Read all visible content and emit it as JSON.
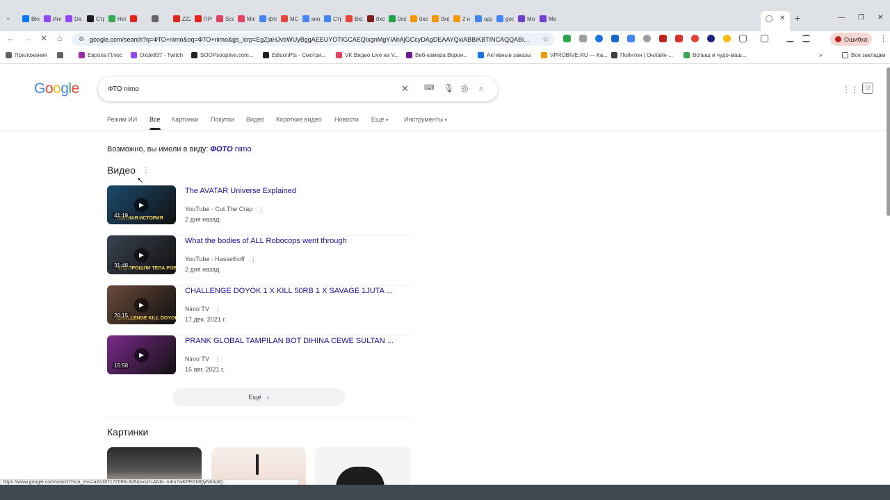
{
  "browser": {
    "tabs": [
      {
        "label": "ВКс",
        "color": "#0077ff"
      },
      {
        "label": "Инс",
        "color": "#9146ff"
      },
      {
        "label": "Da",
        "color": "#9146ff"
      },
      {
        "label": "Стр",
        "color": "#1f1f1f"
      },
      {
        "label": "Нет",
        "color": "#34a853"
      },
      {
        "label": "",
        "color": "#e62117"
      },
      {
        "label": "",
        "color": "#666666"
      },
      {
        "label": "ZZZ",
        "color": "#e62117"
      },
      {
        "label": "ПРС",
        "color": "#e62117"
      },
      {
        "label": "Sca",
        "color": "#e4405f"
      },
      {
        "label": "Min",
        "color": "#e4405f"
      },
      {
        "label": "фто",
        "color": "#4285f4"
      },
      {
        "label": "МС",
        "color": "#ea4335"
      },
      {
        "label": "кно",
        "color": "#4285f4"
      },
      {
        "label": "Стр",
        "color": "#4285f4"
      },
      {
        "label": "Вхо",
        "color": "#ea4335"
      },
      {
        "label": "0xd",
        "color": "#7b1f1f"
      },
      {
        "label": "0xd",
        "color": "#1ea446"
      },
      {
        "label": "0xd",
        "color": "#f29900"
      },
      {
        "label": "0xd",
        "color": "#f29900"
      },
      {
        "label": "2 н",
        "color": "#f29900"
      },
      {
        "label": "ода",
        "color": "#4285f4"
      },
      {
        "label": "goc",
        "color": "#4285f4"
      },
      {
        "label": "Мо",
        "color": "#6f3fd0"
      },
      {
        "label": "Ме",
        "color": "#6f3fd0"
      }
    ],
    "active_tab_close": "✕",
    "new_tab": "+",
    "url": "google.com/search?q=ФТО+nimo&oq=ФТО+nimo&gs_lcrp=EgZjaHJvbWUyBggAEEUYOTIGCAEQIxgnMgYIAhAjGCcyDAgDEAAYQxiABBiKBTINCAQQABi...",
    "error_button": "Ошибка",
    "bookmarks": [
      {
        "label": "Приложения",
        "color": "#5f6368"
      },
      {
        "label": "",
        "color": "#5f6368"
      },
      {
        "label": "Европа Плюс",
        "color": "#9c27b0"
      },
      {
        "label": "Oxde837 - Twitch",
        "color": "#9146ff"
      },
      {
        "label": "SOOPsooplive.com...",
        "color": "#1f1f1f"
      },
      {
        "label": "EdisonPts - Смотри...",
        "color": "#1f1f1f"
      },
      {
        "label": "VK Видео Live на V...",
        "color": "#e4405f"
      },
      {
        "label": "Веб-камера Ворон...",
        "color": "#6a1b9a"
      },
      {
        "label": "Активные заказы",
        "color": "#1a73e8"
      },
      {
        "label": "VPROBIVE.RU — Ка...",
        "color": "#f29900"
      },
      {
        "label": "Пойнтон | Онлайн-...",
        "color": "#3c4043"
      },
      {
        "label": "Вспыш и чудо-маш...",
        "color": "#34a853"
      }
    ],
    "all_bookmarks": "Все закладки",
    "status_url": "https://www.google.com/search?sca_esv=a2a187172096c3d5&sxsrf=ANbL-n4m7wKPEGMQyNlr4olQ..."
  },
  "search": {
    "logo": "Google",
    "query": "ФТО nimo",
    "nav_tabs": [
      "Режим ИИ",
      "Все",
      "Картинки",
      "Покупки",
      "Видео",
      "Короткие видео",
      "Новости",
      "Ещё",
      "Инструменты"
    ],
    "active_tab": "Все",
    "did_you_mean_prefix": "Возможно, вы имели в виду:",
    "did_you_mean_bold": "ФОТО",
    "did_you_mean_rest": "nimo"
  },
  "videos_section": {
    "title": "Видео",
    "items": [
      {
        "title": "The AVATAR Universe Explained",
        "source": "YouTube · Cut The Crap",
        "date": "2 дня назад",
        "duration": "41:19",
        "thumb_color": "#1b4a6e",
        "thumb_caption": "ПОЛНАЯ ИСТОРИЯ"
      },
      {
        "title": "What the bodies of ALL Robocops went through",
        "source": "YouTube · Hasselhoff",
        "date": "2 дня назад",
        "duration": "31:48",
        "thumb_color": "#3a4250",
        "thumb_caption": "ЧТО ПРОШЛИ ТЕЛА РОБОКОПОВ"
      },
      {
        "title": "CHALLENGE DOYOK 1 X KILL 50RB 1 X SAVAGE 1JUTA ...",
        "source": "Nimo TV",
        "date": "17 дек. 2021 г.",
        "duration": "20:15",
        "thumb_color": "#6b4a3a",
        "thumb_caption": "CHALLENGE KILL DOYOK"
      },
      {
        "title": "PRANK GLOBAL TAMPILAN BOT DIHINA CEWE SULTAN ...",
        "source": "Nimo TV",
        "date": "16 авг. 2021 г.",
        "duration": "15:58",
        "thumb_color": "#7a2a8a",
        "thumb_caption": ""
      }
    ],
    "more_label": "Ещё"
  },
  "images_section": {
    "title": "Картинки"
  }
}
